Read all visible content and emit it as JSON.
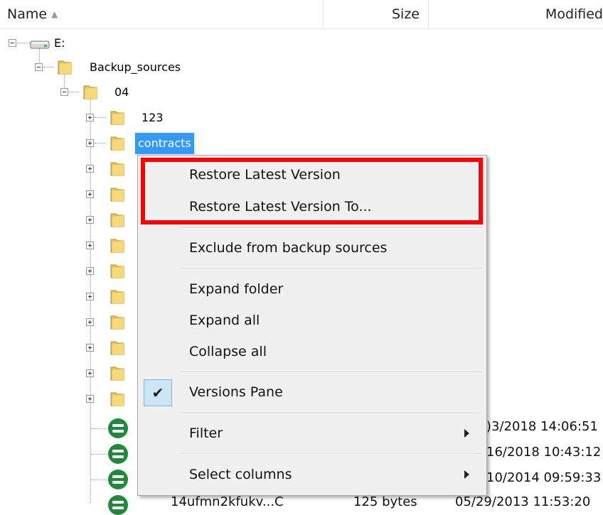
{
  "columns": {
    "name": "Name",
    "size": "Size",
    "modified": "Modified",
    "sort_indicator": "sort-ascending-icon"
  },
  "tree": {
    "drive": {
      "label": "E:",
      "icon": "drive-icon"
    },
    "backup_sources": {
      "label": "Backup_sources",
      "icon": "folder-icon"
    },
    "folder_04": {
      "label": "04",
      "icon": "folder-icon"
    },
    "folder_123": {
      "label": "123",
      "icon": "folder-icon"
    },
    "folder_contracts": {
      "label": "contracts",
      "icon": "folder-icon"
    }
  },
  "files": [
    {
      "modified_partial": ")3/2018 14:06:51"
    },
    {
      "modified_partial": "16/2018 10:43:12"
    },
    {
      "modified_partial": "10/2014 09:59:33"
    },
    {
      "name_partial": "14ufmn2kfukv...C",
      "size_partial": "125 bytes",
      "modified_partial": "05/29/2013 11:53:20"
    }
  ],
  "context_menu": {
    "restore_latest": "Restore Latest Version",
    "restore_latest_to": "Restore Latest Version To...",
    "exclude": "Exclude from backup sources",
    "expand_folder": "Expand folder",
    "expand_all": "Expand all",
    "collapse_all": "Collapse all",
    "versions_pane": "Versions Pane",
    "versions_pane_checked": true,
    "filter": "Filter",
    "select_columns": "Select columns"
  },
  "colors": {
    "selection": "#3399ff",
    "highlight_outline": "#ff0000",
    "status_icon": "#1e8a3a"
  }
}
